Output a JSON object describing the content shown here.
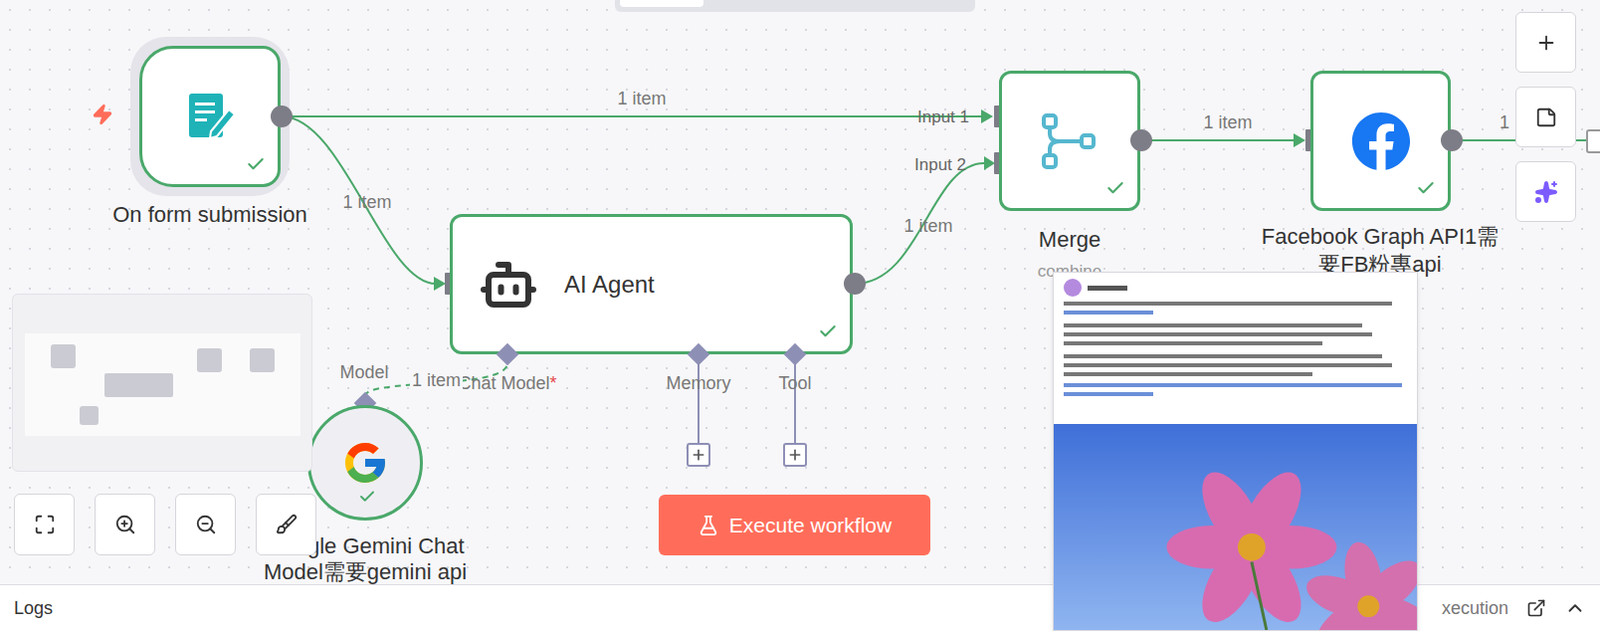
{
  "nodes": {
    "form": {
      "label": "On form submission",
      "executed": true,
      "selected": true
    },
    "agent": {
      "label": "AI Agent",
      "executed": true,
      "ports": [
        {
          "label": "Chat Model",
          "required_mark": "*",
          "connected": true
        },
        {
          "label": "Memory",
          "required_mark": "",
          "connected": false
        },
        {
          "label": "Tool",
          "required_mark": "",
          "connected": false
        }
      ]
    },
    "gemini": {
      "label_lines": [
        "Google Gemini Chat",
        "Model需要gemini api"
      ],
      "port_label": "Model",
      "executed": true
    },
    "merge": {
      "label": "Merge",
      "subtitle": "combine",
      "inputs": [
        "Input 1",
        "Input 2"
      ],
      "executed": true
    },
    "facebook": {
      "label_lines": [
        "Facebook Graph API1需",
        "要FB粉專api"
      ],
      "executed": true
    }
  },
  "edges": {
    "form_to_merge": "1 item",
    "form_to_agent": "1 item",
    "agent_to_merge": "1 item",
    "merge_to_facebook": "1 item",
    "gemini_to_agent": "1 item",
    "facebook_out": "1"
  },
  "execute_button": {
    "label": "Execute workflow"
  },
  "logs_bar": {
    "title": "Logs",
    "execution_label": "xecution"
  }
}
